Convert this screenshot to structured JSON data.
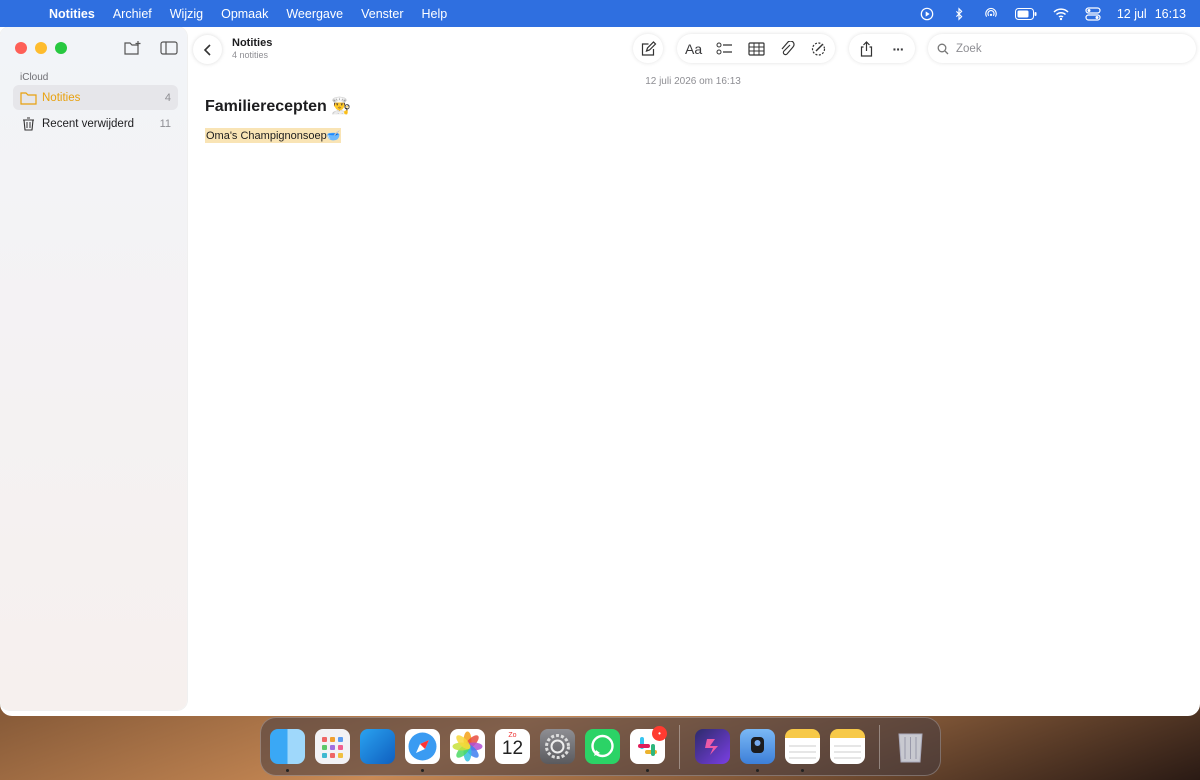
{
  "menubar": {
    "apple_icon": "apple-icon",
    "items": [
      "Notities",
      "Archief",
      "Wijzig",
      "Opmaak",
      "Weergave",
      "Venster",
      "Help"
    ],
    "date": "12 jul",
    "time": "16:13",
    "status_icons": [
      "play-icon",
      "bluetooth-icon",
      "airdrop-icon",
      "battery-icon",
      "wifi-icon",
      "control-center-icon"
    ]
  },
  "sidebar": {
    "section": "iCloud",
    "folders": [
      {
        "label": "Notities",
        "count": "4",
        "icon": "folder-icon"
      },
      {
        "label": "Recent verwijderd",
        "count": "11",
        "icon": "trash-icon"
      }
    ]
  },
  "toolbar": {
    "title": "Notities",
    "subtitle": "4 notities",
    "format_label": "Aa",
    "more_label": "···",
    "search_placeholder": "Zoek"
  },
  "note": {
    "date": "12 juli 2026 om 16:13",
    "title": "Familierecepten 👨‍🍳",
    "line": "Oma's Champignonsoep🥣"
  },
  "dock": {
    "apps": [
      "Finder",
      "Launchpad",
      "Outlook",
      "Safari",
      "Foto's",
      "Agenda",
      "Systeeminstellingen",
      "WhatsApp",
      "Slack",
      "Shortcuts",
      "Sidecar",
      "Notities",
      "Notities",
      "Prullenmand"
    ],
    "calendar_day": "12",
    "calendar_weekday": "Zo",
    "slack_badge": "•",
    "colors": {
      "accent": "#e8a10e",
      "menubar": "#2f6fe0"
    }
  }
}
